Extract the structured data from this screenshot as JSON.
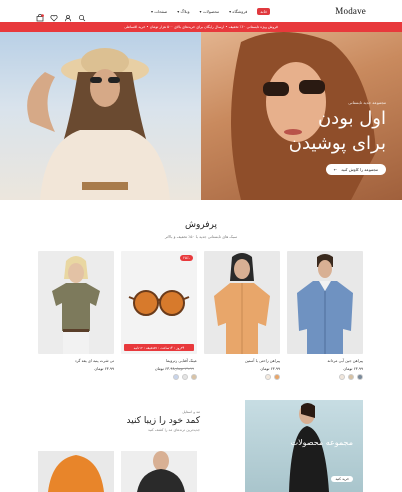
{
  "header": {
    "logo": "Modave",
    "nav": [
      {
        "label": "خانه",
        "hot": true
      },
      {
        "label": "فروشگاه ▾"
      },
      {
        "label": "محصولات ▾"
      },
      {
        "label": "وبلاگ ▾"
      },
      {
        "label": "صفحات ▾"
      }
    ],
    "icons": [
      "search-icon",
      "user-icon",
      "heart-icon",
      "cart-icon"
    ]
  },
  "announcement": "فروش ویژه تابستانی ۶۰٪ تخفیف • ارسال رایگان برای خریدهای بالای ۵۰۰ هزار تومان • خرید اقساطی",
  "hero": {
    "subtitle": "مجموعه جدید تابستانی",
    "title_line1": "اول بودن",
    "title_line2": "برای پوشیدن",
    "button": "مجموعه را کاوش کنید"
  },
  "bestsellers": {
    "title": "پرفروش",
    "subtitle": "سبک های تابستانی جدید با ۵۰٪ تخفیف و بالاتر"
  },
  "products": [
    {
      "name": "پیراهن جین آبی مردانه",
      "price": "۶۳.۹۹ تومان",
      "old": "",
      "swatches": [
        "#7a8a9a",
        "#d7c2a4",
        "#f0e6dc"
      ],
      "badge": "",
      "countdown": ""
    },
    {
      "name": "پیراهن راحتی با آستین",
      "price": "۶۳.۹۹ تومان",
      "old": "",
      "swatches": [
        "#e8a66a",
        "#f3e9de"
      ],
      "badge": "",
      "countdown": ""
    },
    {
      "name": "عینک آفتابی رترویما",
      "price": "۶۳.۹۹ تومان",
      "old": "۷۹.۹۹ تومان",
      "swatches": [
        "#d9c3a6",
        "#e4e4e4",
        "#c8d4ea"
      ],
      "badge": "۲۵٪-",
      "countdown": "۳۴روز : ۱۴ساعت : ۵۷دقیقه : ۱۲ثانیه"
    },
    {
      "name": "تی شرت پنبه ای یقه گرد",
      "price": "۶۳.۹۹ تومان",
      "old": "",
      "swatches": [],
      "badge": "",
      "countdown": ""
    }
  ],
  "promo": {
    "small": "مد و استایل",
    "title": "کمد خود را زیبا کنید",
    "sub": "جدیدترین ترندهای مد را کشف کنید"
  },
  "collection_banner": {
    "title": "مجموعه محصولات",
    "button": "خرید کنید"
  }
}
